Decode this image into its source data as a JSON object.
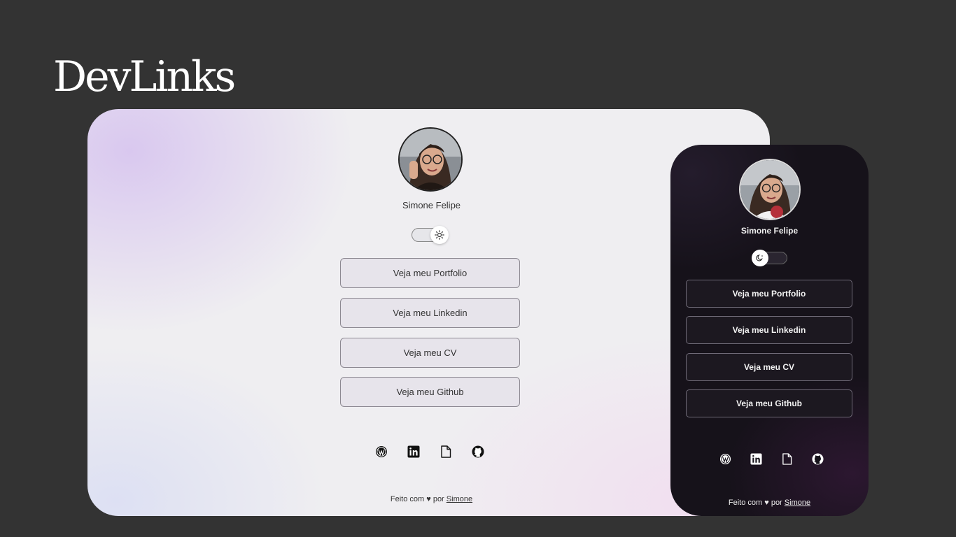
{
  "brand": {
    "title": "DevLinks"
  },
  "desktop": {
    "profile_name": "Simone Felipe",
    "theme": "light",
    "links": [
      {
        "label": "Veja meu Portfolio"
      },
      {
        "label": "Veja meu Linkedin"
      },
      {
        "label": "Veja meu CV"
      },
      {
        "label": "Veja meu Github"
      }
    ],
    "socials": [
      "wordpress-icon",
      "linkedin-icon",
      "document-icon",
      "github-icon"
    ],
    "footer": {
      "prefix": "Feito com ♥ por",
      "author": "Simone"
    }
  },
  "mobile": {
    "profile_name": "Simone Felipe",
    "theme": "dark",
    "links": [
      {
        "label": "Veja meu Portfolio"
      },
      {
        "label": "Veja meu Linkedin"
      },
      {
        "label": "Veja meu CV"
      },
      {
        "label": "Veja meu Github"
      }
    ],
    "socials": [
      "wordpress-icon",
      "linkedin-icon",
      "document-icon",
      "github-icon"
    ],
    "footer": {
      "prefix": "Feito com ♥ por",
      "author": "Simone"
    }
  },
  "colors": {
    "page_bg": "#333333",
    "desktop_bg": "#efeef1",
    "mobile_bg": "#16121a"
  }
}
